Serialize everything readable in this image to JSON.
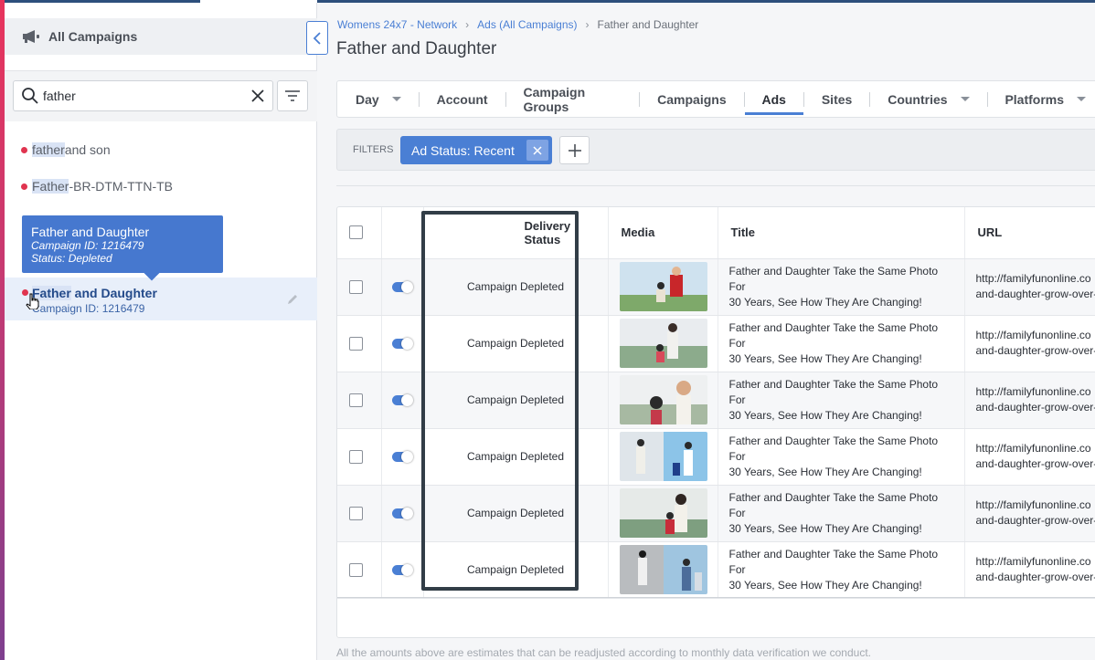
{
  "sidebar": {
    "header_title": "All Campaigns",
    "search": {
      "value": "father",
      "placeholder": ""
    },
    "items": [
      {
        "highlight": "father",
        "rest": " and son"
      },
      {
        "highlight": "Father",
        "rest": "-BR-DTM-TTN-TB"
      }
    ],
    "tooltip": {
      "title": "Father and Daughter",
      "campaign_id": "Campaign ID: 1216479",
      "status": "Status: Depleted"
    },
    "selected": {
      "highlight": "Father",
      "rest": " and Daughter",
      "campaign_id": "Campaign ID: 1216479"
    }
  },
  "breadcrumb": {
    "items": [
      "Womens 24x7 - Network",
      "Ads (All Campaigns)"
    ],
    "current": "Father and Daughter"
  },
  "page_title": "Father and Daughter",
  "tabs": [
    "Day",
    "Account",
    "Campaign Groups",
    "Campaigns",
    "Ads",
    "Sites",
    "Countries",
    "Platforms"
  ],
  "active_tab": "Ads",
  "filters": {
    "label": "FILTERS",
    "chip": "Ad Status: Recent"
  },
  "table": {
    "headers": {
      "delivery": "Delivery Status",
      "media": "Media",
      "title": "Title",
      "url": "URL"
    },
    "rows": [
      {
        "status": "Campaign Depleted",
        "title1": "Father and Daughter Take the Same Photo For",
        "title2": "30 Years, See How They Are Changing!",
        "url1": "http://familyfunonline.co",
        "url2": "and-daughter-grow-over-"
      },
      {
        "status": "Campaign Depleted",
        "title1": "Father and Daughter Take the Same Photo For",
        "title2": "30 Years, See How They Are Changing!",
        "url1": "http://familyfunonline.co",
        "url2": "and-daughter-grow-over-"
      },
      {
        "status": "Campaign Depleted",
        "title1": "Father and Daughter Take the Same Photo For",
        "title2": "30 Years, See How They Are Changing!",
        "url1": "http://familyfunonline.co",
        "url2": "and-daughter-grow-over-"
      },
      {
        "status": "Campaign Depleted",
        "title1": "Father and Daughter Take the Same Photo For",
        "title2": "30 Years, See How They Are Changing!",
        "url1": "http://familyfunonline.co",
        "url2": "and-daughter-grow-over-"
      },
      {
        "status": "Campaign Depleted",
        "title1": "Father and Daughter Take the Same Photo For",
        "title2": "30 Years, See How They Are Changing!",
        "url1": "http://familyfunonline.co",
        "url2": "and-daughter-grow-over-"
      },
      {
        "status": "Campaign Depleted",
        "title1": "Father and Daughter Take the Same Photo For",
        "title2": "30 Years, See How They Are Changing!",
        "url1": "http://familyfunonline.co",
        "url2": "and-daughter-grow-over-"
      }
    ]
  },
  "footnote": "All the amounts above are estimates that can be readjusted according to monthly data verification we conduct.",
  "colors": {
    "accent": "#4a7fd4",
    "status_dot": "#e0344f",
    "tooltip_bg": "#4678cf"
  }
}
